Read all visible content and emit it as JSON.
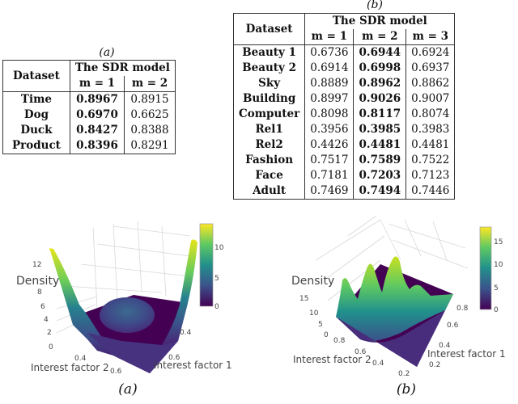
{
  "table_a": {
    "caption": "(a)",
    "header_dataset": "Dataset",
    "header_group": "The SDR model",
    "columns": [
      "m = 1",
      "m = 2"
    ],
    "rows": [
      {
        "dataset": "Time",
        "values": [
          "0.8967",
          "0.8915"
        ],
        "best": 0
      },
      {
        "dataset": "Dog",
        "values": [
          "0.6970",
          "0.6625"
        ],
        "best": 0
      },
      {
        "dataset": "Duck",
        "values": [
          "0.8427",
          "0.8388"
        ],
        "best": 0
      },
      {
        "dataset": "Product",
        "values": [
          "0.8396",
          "0.8291"
        ],
        "best": 0
      }
    ]
  },
  "table_b": {
    "caption": "(b)",
    "header_dataset": "Dataset",
    "header_group": "The SDR model",
    "columns": [
      "m = 1",
      "m = 2",
      "m = 3"
    ],
    "rows": [
      {
        "dataset": "Beauty 1",
        "values": [
          "0.6736",
          "0.6944",
          "0.6924"
        ],
        "best": 1
      },
      {
        "dataset": "Beauty 2",
        "values": [
          "0.6914",
          "0.6998",
          "0.6937"
        ],
        "best": 1
      },
      {
        "dataset": "Sky",
        "values": [
          "0.8889",
          "0.8962",
          "0.8862"
        ],
        "best": 1
      },
      {
        "dataset": "Building",
        "values": [
          "0.8997",
          "0.9026",
          "0.9007"
        ],
        "best": 1
      },
      {
        "dataset": "Computer",
        "values": [
          "0.8098",
          "0.8117",
          "0.8074"
        ],
        "best": 1
      },
      {
        "dataset": "Rel1",
        "values": [
          "0.3956",
          "0.3985",
          "0.3983"
        ],
        "best": 1
      },
      {
        "dataset": "Rel2",
        "values": [
          "0.4426",
          "0.4481",
          "0.4481"
        ],
        "best": 1
      },
      {
        "dataset": "Fashion",
        "values": [
          "0.7517",
          "0.7589",
          "0.7522"
        ],
        "best": 1
      },
      {
        "dataset": "Face",
        "values": [
          "0.7181",
          "0.7203",
          "0.7123"
        ],
        "best": 1
      },
      {
        "dataset": "Adult",
        "values": [
          "0.7469",
          "0.7494",
          "0.7446"
        ],
        "best": 1
      }
    ]
  },
  "chart_data": [
    {
      "type": "surface3d",
      "caption": "(a)",
      "zlabel": "Density",
      "xlabel": "Interest factor 2",
      "ylabel": "Interest factor 1",
      "z_ticks": [
        "0",
        "2",
        "4",
        "6",
        "8",
        "12"
      ],
      "x_ticks": [
        "0.4",
        "0.6"
      ],
      "y_ticks": [
        "0.4",
        "0.6"
      ],
      "colorbar": {
        "ticks": [
          "0",
          "5",
          "10"
        ],
        "range": [
          0,
          13.5
        ],
        "colormap": "viridis"
      },
      "description": "Two high ridges at opposite corners (peak ~13) with a small central bump (~4) over a flat base",
      "peaks": [
        {
          "label": "left-corner ridge",
          "z": 13
        },
        {
          "label": "right-corner ridge",
          "z": 13
        },
        {
          "label": "central bump",
          "z": 4
        }
      ]
    },
    {
      "type": "surface3d",
      "caption": "(b)",
      "zlabel": "Density",
      "xlabel": "Interest factor 2",
      "ylabel": "Interest factor 1",
      "z_ticks": [
        "0",
        "5",
        "10",
        "15"
      ],
      "x_ticks": [
        "0.2",
        "0.4",
        "0.6",
        "0.8"
      ],
      "y_ticks": [
        "0.2",
        "0.4",
        "0.6",
        "0.8"
      ],
      "colorbar": {
        "ticks": [
          "0",
          "5",
          "10",
          "15"
        ],
        "range": [
          0,
          18
        ],
        "colormap": "viridis"
      },
      "description": "Row of peaks along one edge decreasing toward the far corner",
      "peaks": [
        {
          "label": "peak 1",
          "z": 14
        },
        {
          "label": "peak 2",
          "z": 16
        },
        {
          "label": "peak 3",
          "z": 17
        },
        {
          "label": "peak 4",
          "z": 7
        },
        {
          "label": "peak 5",
          "z": 2
        }
      ]
    }
  ],
  "captions": {
    "left": "(a)",
    "right": "(b)"
  }
}
